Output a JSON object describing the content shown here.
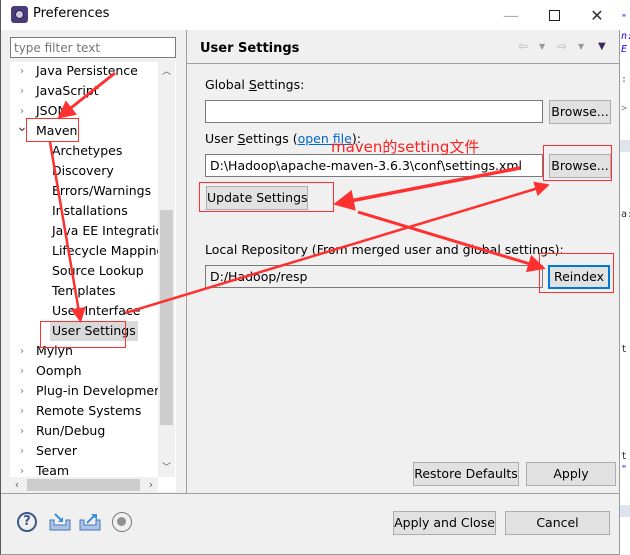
{
  "window": {
    "title": "Preferences",
    "controls": {
      "minimize": "—",
      "close": "✕"
    }
  },
  "left_panel": {
    "filter_placeholder": "type filter text",
    "tree": [
      {
        "label": "Java Persistence",
        "level": 0,
        "expanded": false
      },
      {
        "label": "JavaScript",
        "level": 0,
        "expanded": false
      },
      {
        "label": "JSON",
        "level": 0,
        "expanded": false
      },
      {
        "label": "Maven",
        "level": 0,
        "expanded": true
      },
      {
        "label": "Archetypes",
        "level": 1
      },
      {
        "label": "Discovery",
        "level": 1
      },
      {
        "label": "Errors/Warnings",
        "level": 1
      },
      {
        "label": "Installations",
        "level": 1
      },
      {
        "label": "Java EE Integration",
        "level": 1
      },
      {
        "label": "Lifecycle Mappings",
        "level": 1
      },
      {
        "label": "Source Lookup",
        "level": 1
      },
      {
        "label": "Templates",
        "level": 1
      },
      {
        "label": "User Interface",
        "level": 1
      },
      {
        "label": "User Settings",
        "level": 1,
        "selected": true
      },
      {
        "label": "Mylyn",
        "level": 0,
        "expanded": false
      },
      {
        "label": "Oomph",
        "level": 0,
        "expanded": false
      },
      {
        "label": "Plug-in Development",
        "level": 0,
        "expanded": false
      },
      {
        "label": "Remote Systems",
        "level": 0,
        "expanded": false
      },
      {
        "label": "Run/Debug",
        "level": 0,
        "expanded": false
      },
      {
        "label": "Server",
        "level": 0,
        "expanded": false
      },
      {
        "label": "Team",
        "level": 0,
        "expanded": false
      }
    ]
  },
  "page": {
    "title": "User Settings",
    "global_settings": {
      "label_prefix": "Global ",
      "label_mnemonic": "S",
      "label_suffix": "ettings:",
      "value": "",
      "browse_label": "Browse..."
    },
    "user_settings": {
      "label_prefix": "User ",
      "label_mnemonic": "S",
      "label_suffix": "ettings (",
      "link_text": "open file",
      "label_end": "):",
      "value": "D:\\Hadoop\\apache-maven-3.6.3\\conf\\settings.xml",
      "browse_label": "Browse...",
      "update_label": "Update Settings"
    },
    "local_repository": {
      "label": "Local Repository (From merged user and global settings):",
      "value": "D:/Hadoop/resp",
      "reindex_label": "Reindex"
    },
    "restore_defaults_label": "Restore Defaults",
    "apply_label": "Apply"
  },
  "footer": {
    "apply_close_label": "Apply and Close",
    "cancel_label": "Cancel"
  },
  "annotation": {
    "text": "maven的setting文件",
    "color": "#ff2020"
  },
  "background_editor": {
    "glyphs": [
      "\"",
      "n:",
      "E",
      ":",
      ">",
      "a:",
      "t",
      "\""
    ]
  }
}
